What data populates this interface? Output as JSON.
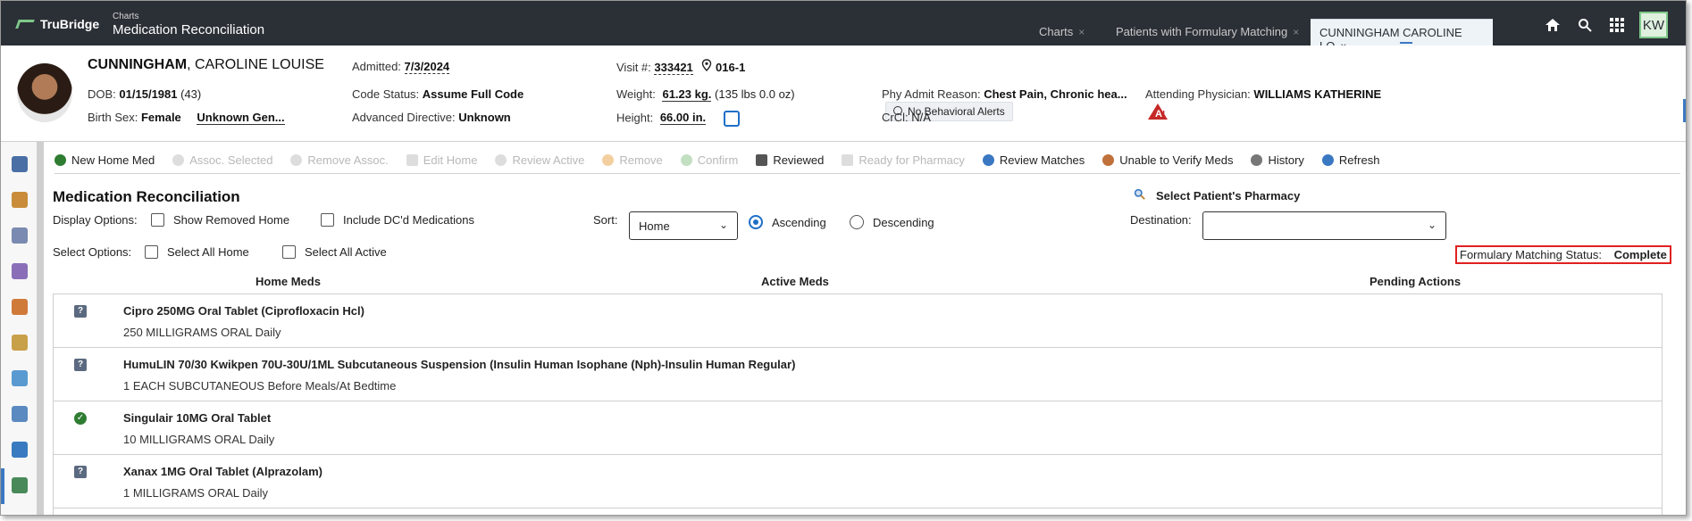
{
  "app": {
    "logo_text": "TruBridge",
    "breadcrumb_small": "Charts",
    "page_title": "Medication Reconciliation"
  },
  "tabs": [
    {
      "label": "Charts"
    },
    {
      "label": "Patients with Formulary Matching"
    },
    {
      "label": "CUNNINGHAM CAROLINE LO"
    }
  ],
  "user": {
    "initials": "KW"
  },
  "patient": {
    "last_name": "CUNNINGHAM",
    "first_name": ", CAROLINE LOUISE",
    "dob_label": "DOB:",
    "dob": "01/15/1981",
    "age": "(43)",
    "sex_label": "Birth Sex:",
    "sex": "Female",
    "gender": "Unknown Gen...",
    "admitted_label": "Admitted:",
    "admitted": "7/3/2024",
    "code_label": "Code Status:",
    "code": "Assume Full Code",
    "directive_label": "Advanced Directive:",
    "directive": "Unknown",
    "visit_label": "Visit #:",
    "visit": "333421",
    "room": "016-1",
    "weight_label": "Weight:",
    "weight": "61.23 kg.",
    "weight_lbs": "(135 lbs 0.0 oz)",
    "height_label": "Height:",
    "height": "66.00 in.",
    "behavioral": "No Behavioral Alerts",
    "admit_reason_label": "Phy Admit Reason:",
    "admit_reason": "Chest Pain, Chronic hea...",
    "crcl_label": "CrCl:",
    "crcl": "N/A",
    "attending_label": "Attending Physician:",
    "attending": "WILLIAMS KATHERINE"
  },
  "toolbar": [
    {
      "label": "New Home Med",
      "enabled": true,
      "icon": "plus-circle-icon",
      "color": "#2e7d32"
    },
    {
      "label": "Assoc. Selected",
      "enabled": false,
      "icon": "link-icon",
      "color": "#cccccc"
    },
    {
      "label": "Remove Assoc.",
      "enabled": false,
      "icon": "unlink-icon",
      "color": "#cccccc"
    },
    {
      "label": "Edit Home",
      "enabled": false,
      "icon": "edit-icon",
      "color": "#cccccc"
    },
    {
      "label": "Review Active",
      "enabled": false,
      "icon": "search-icon",
      "color": "#cccccc"
    },
    {
      "label": "Remove",
      "enabled": false,
      "icon": "remove-icon",
      "color": "#f0c080"
    },
    {
      "label": "Confirm",
      "enabled": false,
      "icon": "check-icon",
      "color": "#b0d8b0"
    },
    {
      "label": "Reviewed",
      "enabled": true,
      "icon": "document-check-icon",
      "color": "#444444"
    },
    {
      "label": "Ready for Pharmacy",
      "enabled": false,
      "icon": "document-icon",
      "color": "#cccccc"
    },
    {
      "label": "Review Matches",
      "enabled": true,
      "icon": "search-icon",
      "color": "#3b78c2"
    },
    {
      "label": "Unable to Verify Meds",
      "enabled": true,
      "icon": "pills-icon",
      "color": "#c0703a"
    },
    {
      "label": "History",
      "enabled": true,
      "icon": "history-icon",
      "color": "#666666"
    },
    {
      "label": "Refresh",
      "enabled": true,
      "icon": "refresh-icon",
      "color": "#3b78c2"
    }
  ],
  "main": {
    "title": "Medication Reconciliation",
    "display_options_label": "Display Options:",
    "show_removed_home": "Show Removed Home",
    "include_dc": "Include DC'd Medications",
    "select_options_label": "Select Options:",
    "select_all_home": "Select All Home",
    "select_all_active": "Select All Active",
    "sort_label": "Sort:",
    "sort_value": "Home",
    "ascending": "Ascending",
    "descending": "Descending",
    "pharmacy_title": "Select Patient's Pharmacy",
    "destination_label": "Destination:",
    "destination_value": "",
    "fm_status_label": "Formulary Matching Status:",
    "fm_status_value": "Complete",
    "col_home": "Home Meds",
    "col_active": "Active Meds",
    "col_pending": "Pending Actions"
  },
  "meds": [
    {
      "status": "unknown",
      "name": "Cipro 250MG Oral Tablet (Ciprofloxacin Hcl)",
      "sig": "250 MILLIGRAMS ORAL Daily"
    },
    {
      "status": "unknown",
      "name": "HumuLIN 70/30 Kwikpen 70U-30U/1ML Subcutaneous Suspension (Insulin Human Isophane (Nph)-Insulin Human Regular)",
      "sig": "1 EACH SUBCUTANEOUS Before Meals/At Bedtime"
    },
    {
      "status": "verified",
      "name": "Singulair 10MG Oral Tablet",
      "sig": "10 MILLIGRAMS ORAL Daily"
    },
    {
      "status": "unknown",
      "name": "Xanax 1MG Oral Tablet (Alprazolam)",
      "sig": "1 MILLIGRAMS ORAL Daily"
    }
  ]
}
